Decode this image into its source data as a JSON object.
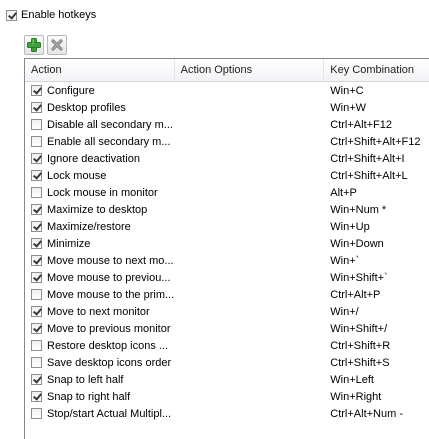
{
  "enable_hotkeys": {
    "label": "Enable hotkeys",
    "checked": true
  },
  "toolbar": {
    "add_icon": "plus-icon",
    "remove_icon": "delete-x-icon"
  },
  "columns": [
    "Action",
    "Action Options",
    "Key Combination"
  ],
  "rows": [
    {
      "checked": true,
      "action": "Configure",
      "options": "",
      "keys": "Win+C"
    },
    {
      "checked": true,
      "action": "Desktop profiles",
      "options": "",
      "keys": "Win+W"
    },
    {
      "checked": false,
      "action": "Disable all secondary m...",
      "options": "",
      "keys": "Ctrl+Alt+F12"
    },
    {
      "checked": false,
      "action": "Enable all secondary m...",
      "options": "",
      "keys": "Ctrl+Shift+Alt+F12"
    },
    {
      "checked": true,
      "action": "Ignore deactivation",
      "options": "",
      "keys": "Ctrl+Shift+Alt+I"
    },
    {
      "checked": true,
      "action": "Lock mouse",
      "options": "",
      "keys": "Ctrl+Shift+Alt+L"
    },
    {
      "checked": false,
      "action": "Lock mouse in monitor",
      "options": "",
      "keys": "Alt+P"
    },
    {
      "checked": true,
      "action": "Maximize to desktop",
      "options": "",
      "keys": "Win+Num *"
    },
    {
      "checked": true,
      "action": "Maximize/restore",
      "options": "",
      "keys": "Win+Up"
    },
    {
      "checked": true,
      "action": "Minimize",
      "options": "",
      "keys": "Win+Down"
    },
    {
      "checked": true,
      "action": "Move mouse to next mo...",
      "options": "",
      "keys": "Win+`"
    },
    {
      "checked": true,
      "action": "Move mouse to previou...",
      "options": "",
      "keys": "Win+Shift+`"
    },
    {
      "checked": false,
      "action": "Move mouse to the prim...",
      "options": "",
      "keys": "Ctrl+Alt+P"
    },
    {
      "checked": true,
      "action": "Move to next monitor",
      "options": "",
      "keys": "Win+/"
    },
    {
      "checked": true,
      "action": "Move to previous monitor",
      "options": "",
      "keys": "Win+Shift+/"
    },
    {
      "checked": false,
      "action": "Restore desktop icons ...",
      "options": "",
      "keys": "Ctrl+Shift+R"
    },
    {
      "checked": false,
      "action": "Save desktop icons order",
      "options": "",
      "keys": "Ctrl+Shift+S"
    },
    {
      "checked": true,
      "action": "Snap to left half",
      "options": "",
      "keys": "Win+Left"
    },
    {
      "checked": true,
      "action": "Snap to right half",
      "options": "",
      "keys": "Win+Right"
    },
    {
      "checked": false,
      "action": "Stop/start Actual Multipl...",
      "options": "",
      "keys": "Ctrl+Alt+Num -"
    }
  ]
}
